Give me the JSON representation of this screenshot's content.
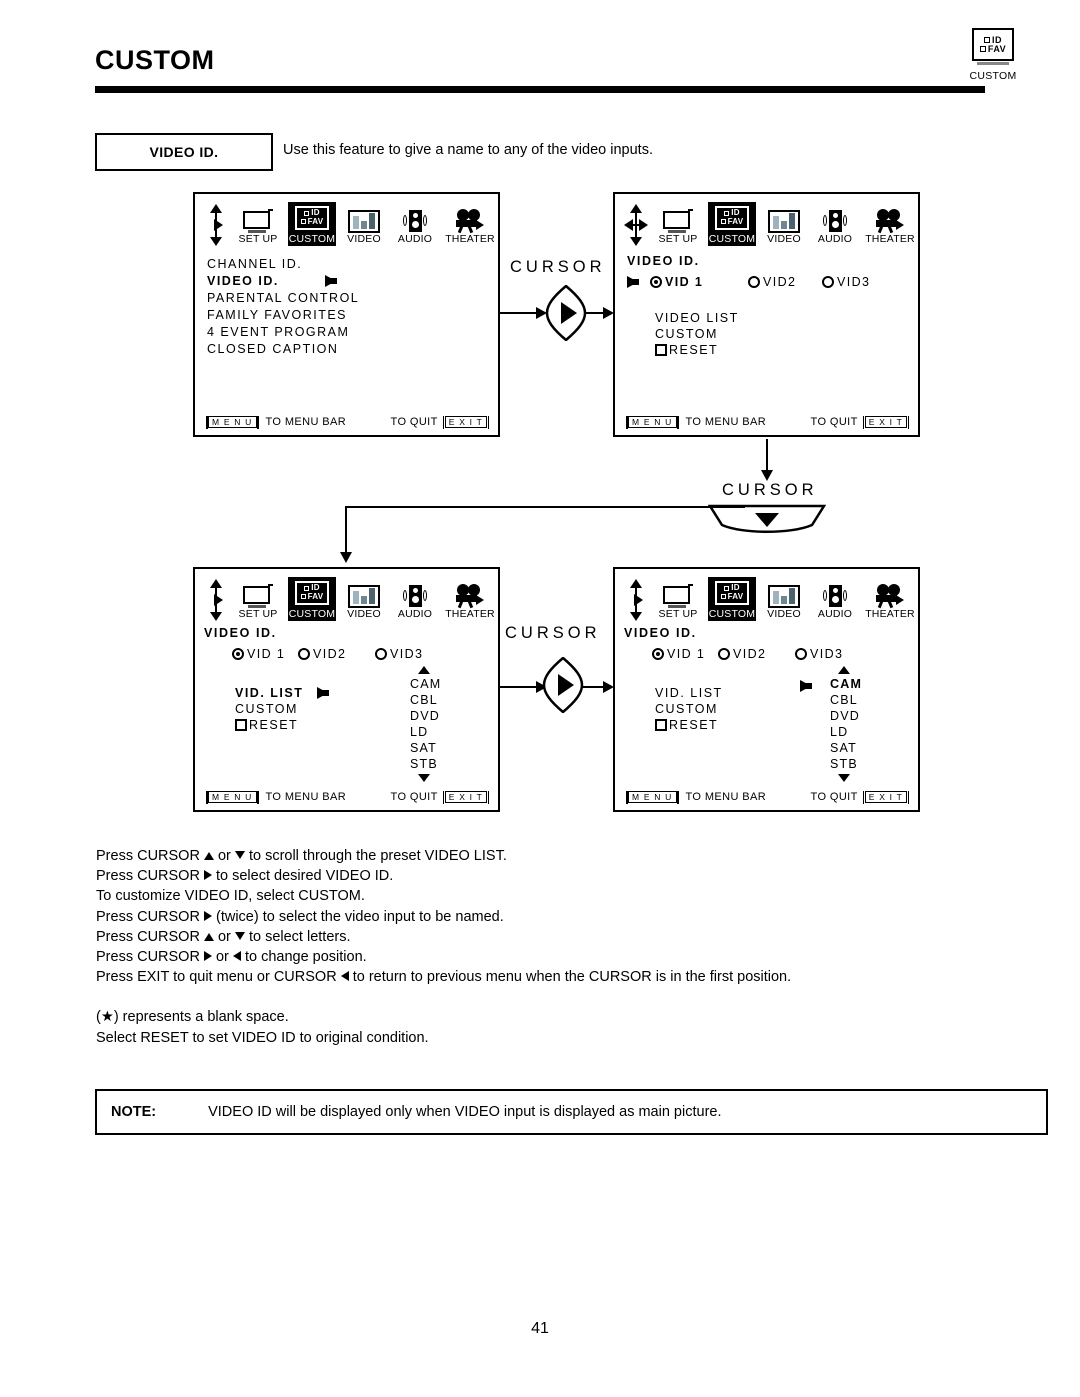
{
  "header": {
    "title": "CUSTOM",
    "icon_rows": [
      "ID",
      "FAV"
    ],
    "icon_caption": "CUSTOM"
  },
  "feature": {
    "label": "VIDEO ID.",
    "description": "Use this feature to give a name to any of the video inputs."
  },
  "menubar": {
    "items": [
      {
        "label": "SET UP",
        "icon": "tv-setup-icon",
        "selected": false
      },
      {
        "label": "CUSTOM",
        "icon": "id-fav-custom-icon",
        "selected": true
      },
      {
        "label": "VIDEO",
        "icon": "video-bars-icon",
        "selected": false
      },
      {
        "label": "AUDIO",
        "icon": "speaker-icon",
        "selected": false
      },
      {
        "label": "THEATER",
        "icon": "projector-icon",
        "selected": false
      }
    ],
    "custom_icon_rows": [
      "ID",
      "FAV"
    ]
  },
  "footer": {
    "menu_key": "M E N U",
    "menu_text": "TO MENU BAR",
    "quit_text": "TO QUIT",
    "exit_key": "E X I T"
  },
  "panel1": {
    "name": "custom-menu-panel",
    "cursor_arrows": [
      "up",
      "right",
      "down"
    ],
    "items": [
      {
        "label": "CHANNEL ID.",
        "selected": false,
        "pointer": false
      },
      {
        "label": "VIDEO ID.",
        "selected": true,
        "pointer": true
      },
      {
        "label": "PARENTAL CONTROL",
        "selected": false,
        "pointer": false
      },
      {
        "label": "FAMILY FAVORITES",
        "selected": false,
        "pointer": false
      },
      {
        "label": "4 EVENT PROGRAM",
        "selected": false,
        "pointer": false
      },
      {
        "label": "CLOSED CAPTION",
        "selected": false,
        "pointer": false
      }
    ]
  },
  "panel2": {
    "name": "video-id-select-panel",
    "cursor_arrows": [
      "up",
      "right",
      "down",
      "left"
    ],
    "title": "VIDEO ID.",
    "inputs": [
      {
        "label": "VID 1",
        "checked": true,
        "selected": true,
        "pointer": true
      },
      {
        "label": "VID2",
        "checked": false,
        "selected": false,
        "pointer": false
      },
      {
        "label": "VID3",
        "checked": false,
        "selected": false,
        "pointer": false
      }
    ],
    "options": [
      {
        "label": "VIDEO LIST",
        "checkbox": false
      },
      {
        "label": "CUSTOM",
        "checkbox": false
      },
      {
        "label": "RESET",
        "checkbox": true
      }
    ]
  },
  "panel3": {
    "name": "vid-list-panel",
    "cursor_arrows": [
      "up",
      "right",
      "down"
    ],
    "title": "VIDEO ID.",
    "inputs": [
      {
        "label": "VID 1",
        "checked": true,
        "selected": false,
        "pointer": false
      },
      {
        "label": "VID2",
        "checked": false,
        "selected": false,
        "pointer": false
      },
      {
        "label": "VID3",
        "checked": false,
        "selected": false,
        "pointer": false
      }
    ],
    "options": [
      {
        "label": "VID.  LIST",
        "checkbox": false,
        "selected": true,
        "pointer": true
      },
      {
        "label": "CUSTOM",
        "checkbox": false,
        "selected": false,
        "pointer": false
      },
      {
        "label": "RESET",
        "checkbox": true,
        "selected": false,
        "pointer": false
      }
    ],
    "video_list": [
      "CAM",
      "CBL",
      "DVD",
      "LD",
      "SAT",
      "STB"
    ],
    "video_list_selected": null,
    "scroll_up": "▲",
    "scroll_down": "▼"
  },
  "panel4": {
    "name": "vid-list-item-panel",
    "cursor_arrows": [
      "up",
      "right",
      "down"
    ],
    "title": "VIDEO ID.",
    "inputs": [
      {
        "label": "VID 1",
        "checked": true,
        "selected": false,
        "pointer": false
      },
      {
        "label": "VID2",
        "checked": false,
        "selected": false,
        "pointer": false
      },
      {
        "label": "VID3",
        "checked": false,
        "selected": false,
        "pointer": false
      }
    ],
    "options": [
      {
        "label": "VID.  LIST",
        "checkbox": false,
        "selected": false,
        "pointer": false
      },
      {
        "label": "CUSTOM",
        "checkbox": false,
        "selected": false,
        "pointer": false
      },
      {
        "label": "RESET",
        "checkbox": true,
        "selected": false,
        "pointer": false
      }
    ],
    "video_list": [
      "CAM",
      "CBL",
      "DVD",
      "LD",
      "SAT",
      "STB"
    ],
    "video_list_selected": "CAM",
    "scroll_up": "▲",
    "scroll_down": "▼"
  },
  "flow": {
    "cursor_right_top": "CURSOR",
    "cursor_down": "CURSOR",
    "cursor_right_bottom": "CURSOR"
  },
  "instructions": {
    "lines": [
      {
        "pre": "Press CURSOR ",
        "g1": "up",
        "mid": " or ",
        "g2": "down",
        "post": " to scroll through the preset VIDEO LIST."
      },
      {
        "pre": "Press CURSOR ",
        "g1": "right",
        "mid": "",
        "g2": null,
        "post": " to select desired VIDEO ID."
      },
      {
        "pre": "To customize VIDEO ID, select CUSTOM.",
        "g1": null,
        "mid": "",
        "g2": null,
        "post": ""
      },
      {
        "pre": "Press CURSOR ",
        "g1": "right",
        "mid": "",
        "g2": null,
        "post": " (twice) to select the video input to be named."
      },
      {
        "pre": "Press CURSOR ",
        "g1": "up",
        "mid": " or ",
        "g2": "down",
        "post": " to select letters."
      },
      {
        "pre": "Press CURSOR ",
        "g1": "right",
        "mid": " or ",
        "g2": "left",
        "post": " to change position."
      },
      {
        "pre": "Press EXIT to quit menu or CURSOR ",
        "g1": "left",
        "mid": "",
        "g2": null,
        "post": " to return to previous menu when the CURSOR is in the first position."
      }
    ],
    "blank_space_note": "(★) represents a blank space.",
    "reset_note": "Select RESET to set VIDEO ID to original condition."
  },
  "note": {
    "label": "NOTE:",
    "text": "VIDEO ID will be displayed only when VIDEO input is displayed as main picture."
  },
  "page_number": "41"
}
